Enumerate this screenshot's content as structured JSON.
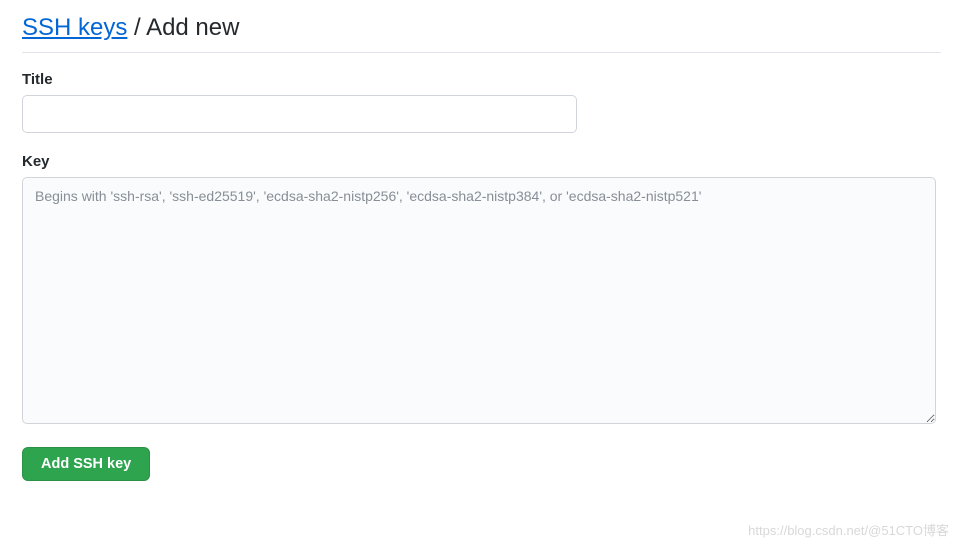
{
  "heading": {
    "link_text": "SSH keys",
    "separator": " / ",
    "current": "Add new"
  },
  "form": {
    "title_label": "Title",
    "title_value": "",
    "key_label": "Key",
    "key_value": "",
    "key_placeholder": "Begins with 'ssh-rsa', 'ssh-ed25519', 'ecdsa-sha2-nistp256', 'ecdsa-sha2-nistp384', or 'ecdsa-sha2-nistp521'",
    "submit_label": "Add SSH key"
  },
  "watermark": "https://blog.csdn.net/@51CTO博客"
}
